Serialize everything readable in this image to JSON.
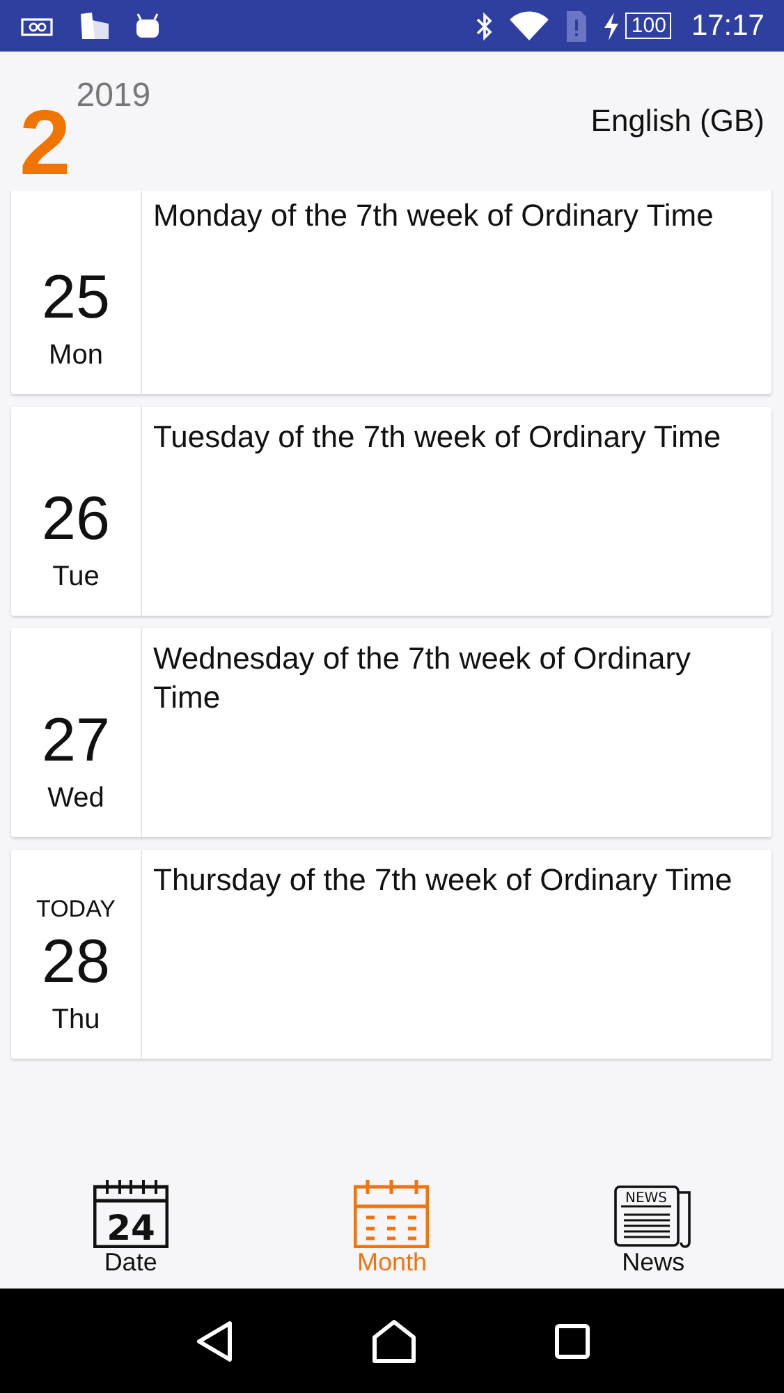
{
  "status_bar": {
    "battery_level": "100",
    "time": "17:17"
  },
  "header": {
    "month": "2",
    "year": "2019",
    "language": "English (GB)"
  },
  "days": [
    {
      "day": "25",
      "weekday": "Mon",
      "title": "Monday of the 7th week of Ordinary Time"
    },
    {
      "day": "26",
      "weekday": "Tue",
      "title": "Tuesday of the 7th week of Ordinary Time"
    },
    {
      "day": "27",
      "weekday": "Wed",
      "title": "Wednesday of the 7th week of Ordinary Time"
    },
    {
      "day": "28",
      "weekday": "Thu",
      "today_label": "TODAY",
      "title": "Thursday of the 7th week of Ordinary Time"
    }
  ],
  "bottom_nav": [
    {
      "kind": "date",
      "label": "Date",
      "icon_text": "24",
      "selected": false
    },
    {
      "kind": "month",
      "label": "Month",
      "selected": true
    },
    {
      "kind": "news",
      "label": "News",
      "icon_text": "NEWS",
      "selected": false
    }
  ]
}
